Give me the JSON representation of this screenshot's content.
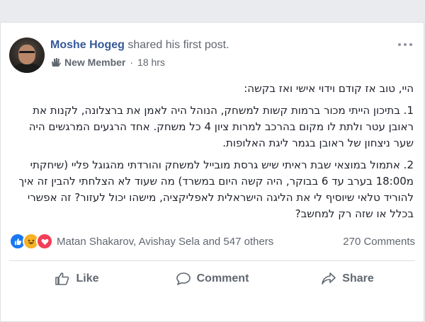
{
  "post": {
    "author": "Moshe Hogeg",
    "action": " shared his first post.",
    "badge": "New Member",
    "separator": "·",
    "timestamp": "18 hrs",
    "paragraphs": [
      "היי, טוב אז קודם וידוי אישי ואז בקשה:",
      "1. בתיכון הייתי מכור ברמות קשות למשחק, הנוהל היה לאמן את ברצלונה, לקנות את ראובן עטר ולתת לו מקום בהרכב למרות ציון 4 כל משחק. אחד הרגעים המרגשים היה שער ניצחון של ראובן בגמר ליגת האלופות.",
      "2. אתמול במוצאי שבת ראיתי שיש גרסת מובייל למשחק והורדתי מהגוגל פליי (שיחקתי מ18:00 בערב עד 6 בבוקר, היה קשה היום במשרד) מה שעוד לא הצלחתי להבין זה איך להוריד טלאי שיוסיף לי את הליגה הישראלית לאפליקציה, מישהו יכול לעזור? זה אפשרי בכלל או שזה רק למחשב?"
    ]
  },
  "reactions": {
    "icons": [
      "like-reaction-icon",
      "haha-reaction-icon",
      "love-reaction-icon"
    ],
    "reactors": "Matan Shakarov, Avishay Sela and 547 others",
    "comments": "270 Comments",
    "colors": {
      "like": "#1877f2",
      "haha": "#f7b125",
      "love": "#f33e58"
    }
  },
  "actions": {
    "like": "Like",
    "comment": "Comment",
    "share": "Share"
  },
  "colors": {
    "link": "#365899",
    "secondary_text": "#616770",
    "background": "#e9ebee"
  }
}
